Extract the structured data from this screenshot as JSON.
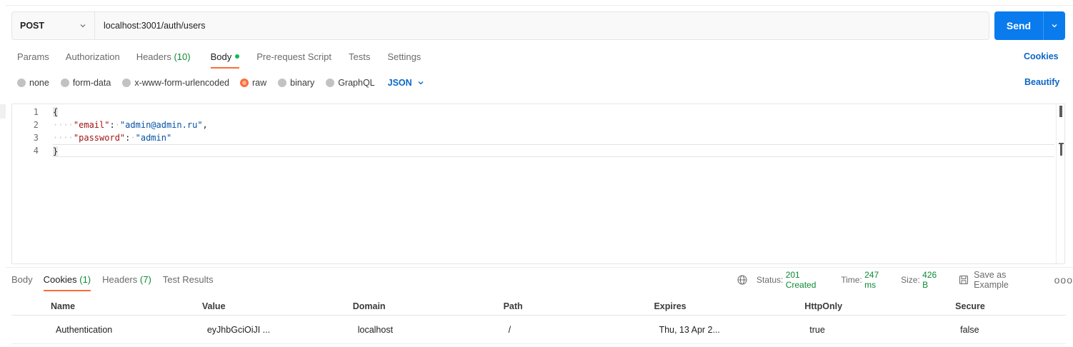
{
  "request": {
    "method": "POST",
    "url": "localhost:3001/auth/users",
    "send_label": "Send"
  },
  "request_tabs": [
    {
      "label": "Params"
    },
    {
      "label": "Authorization"
    },
    {
      "label": "Headers",
      "count": "(10)"
    },
    {
      "label": "Body",
      "active": true
    },
    {
      "label": "Pre-request Script"
    },
    {
      "label": "Tests"
    },
    {
      "label": "Settings"
    }
  ],
  "cookies_link": "Cookies",
  "body_types": [
    {
      "label": "none"
    },
    {
      "label": "form-data"
    },
    {
      "label": "x-www-form-urlencoded"
    },
    {
      "label": "raw",
      "selected": true
    },
    {
      "label": "binary"
    },
    {
      "label": "GraphQL"
    }
  ],
  "body_format": "JSON",
  "beautify_label": "Beautify",
  "editor": {
    "line_numbers": [
      "1",
      "2",
      "3",
      "4"
    ],
    "open_brace": "{",
    "close_brace": "}",
    "indent_dots": "····",
    "email_key": "\"email\"",
    "email_value": "\"admin@admin.ru\"",
    "password_key": "\"password\"",
    "password_value": "\"admin\""
  },
  "response_tabs": [
    {
      "label": "Body"
    },
    {
      "label": "Cookies",
      "count": "(1)",
      "active": true
    },
    {
      "label": "Headers",
      "count": "(7)"
    },
    {
      "label": "Test Results"
    }
  ],
  "response_status": {
    "status_label": "Status:",
    "status_value": "201 Created",
    "time_label": "Time:",
    "time_value": "247 ms",
    "size_label": "Size:",
    "size_value": "426 B",
    "save_label": "Save as Example",
    "more": "ooo"
  },
  "cookies_table": {
    "columns": [
      "Name",
      "Value",
      "Domain",
      "Path",
      "Expires",
      "HttpOnly",
      "Secure"
    ],
    "rows": [
      [
        "Authentication",
        "eyJhbGciOiJI ...",
        "localhost",
        "/",
        "Thu, 13 Apr 2...",
        "true",
        "false"
      ]
    ]
  },
  "colors": {
    "accent": "#ff6c37",
    "primary": "#097bed",
    "link": "#0b67c7",
    "success": "#0d8a33"
  }
}
